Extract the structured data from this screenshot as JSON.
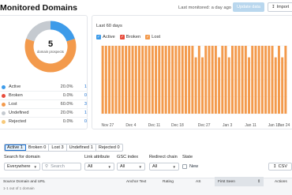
{
  "header": {
    "title": "Monitored Domains",
    "last_monitored": "Last monitored: a day ago",
    "update_label": "Update data",
    "import_label": "Import"
  },
  "summary": {
    "total": "5",
    "total_label": "domain prospects",
    "items": [
      {
        "name": "Active",
        "pct": "20.0%",
        "count": "1",
        "color": "#3d9be9"
      },
      {
        "name": "Broken",
        "pct": "0.0%",
        "count": "0",
        "color": "#e84d3d"
      },
      {
        "name": "Lost",
        "pct": "60.0%",
        "count": "3",
        "color": "#f39a4c"
      },
      {
        "name": "Undefined",
        "pct": "20.0%",
        "count": "1",
        "color": "#c5cad0"
      },
      {
        "name": "Rejected",
        "pct": "0.0%",
        "count": "0",
        "color": "#f7c97a"
      }
    ]
  },
  "chart": {
    "title": "Last 60 days",
    "legend": [
      {
        "name": "Active",
        "color": "#3d9be9"
      },
      {
        "name": "Broken",
        "color": "#e84d3d"
      },
      {
        "name": "Lost",
        "color": "#f39a4c"
      }
    ],
    "x_ticks": [
      "Nov 27",
      "Dec 4",
      "Dec 11",
      "Dec 18",
      "Dec 27",
      "Jan 3",
      "Jan 11",
      "Jan 18",
      "Jan 24"
    ]
  },
  "chart_data": {
    "type": "bar",
    "title": "Last 60 days",
    "series": [
      {
        "name": "Lost",
        "color": "#f39a4c",
        "values": [
          1,
          1,
          1,
          1,
          1,
          1,
          1,
          1,
          1,
          1,
          1,
          1,
          1,
          1,
          1,
          1,
          1,
          1,
          1,
          1,
          1,
          1,
          1,
          1,
          1,
          1,
          1,
          1,
          0.83,
          1,
          0.83,
          1,
          1,
          1,
          1,
          0.83,
          1,
          1,
          0.83,
          1,
          1,
          1,
          1,
          1,
          0.83,
          1,
          1,
          1,
          1,
          1,
          1,
          1,
          0.83,
          1,
          0.83,
          1
        ]
      }
    ],
    "xlabel": "",
    "ylabel": ""
  },
  "filters": {
    "tabs": [
      {
        "label": "Active",
        "count": "1",
        "active": true
      },
      {
        "label": "Broken",
        "count": "0",
        "active": false
      },
      {
        "label": "Lost",
        "count": "3",
        "active": false
      },
      {
        "label": "Undefined",
        "count": "1",
        "active": false
      },
      {
        "label": "Rejected",
        "count": "0",
        "active": false
      }
    ],
    "search_label": "Search for domain",
    "scope_value": "Everywhere",
    "search_placeholder": "Search",
    "link_attr_label": "Link attribute",
    "link_attr_value": "All",
    "gsc_label": "GSC index",
    "gsc_value": "All",
    "redirect_label": "Redirect chain",
    "redirect_value": "All",
    "state_label": "State",
    "state_new": "New",
    "csv_label": "CSV"
  },
  "table": {
    "columns": [
      "Source Domain and URL",
      "Anchor Text",
      "Rating",
      "AS",
      "First Seen",
      "Actions"
    ],
    "count_text": "1-1 out of 1 domain"
  }
}
